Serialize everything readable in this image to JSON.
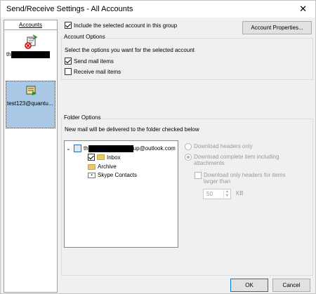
{
  "window": {
    "title": "Send/Receive Settings - All Accounts",
    "close_glyph": "✕"
  },
  "accounts": {
    "header": "Accounts",
    "items": [
      {
        "label_prefix": "th",
        "icon": "account-sync-icon",
        "selected": false
      },
      {
        "label": "test123@quantu...",
        "icon": "account-sync-icon",
        "selected": true
      }
    ]
  },
  "top": {
    "include_label": "Include the selected account in this group",
    "include_checked": true,
    "account_properties_button": "Account Properties..."
  },
  "account_options": {
    "title": "Account Options",
    "description": "Select the options you want for the selected account",
    "send_label": "Send mail items",
    "send_checked": true,
    "receive_label": "Receive mail items",
    "receive_checked": false
  },
  "folder_options": {
    "title": "Folder Options",
    "description": "New mail will be delivered to the folder checked below",
    "tree": {
      "account_prefix": "th",
      "account_suffix": "up@outlook.com",
      "folders": [
        {
          "label": "Inbox",
          "checked": true,
          "type": "folder"
        },
        {
          "label": "Archive",
          "checked": false,
          "type": "folder"
        },
        {
          "label": "Skype Contacts",
          "checked": false,
          "type": "contacts"
        }
      ]
    },
    "download_headers_only": "Download headers only",
    "download_complete_line1": "Download complete item including",
    "download_complete_line2": "attachments",
    "download_only_headers_line1": "Download only headers for items",
    "download_only_headers_line2": "larger than",
    "size_value": "50",
    "size_unit": "KB"
  },
  "buttons": {
    "ok": "OK",
    "cancel": "Cancel"
  }
}
